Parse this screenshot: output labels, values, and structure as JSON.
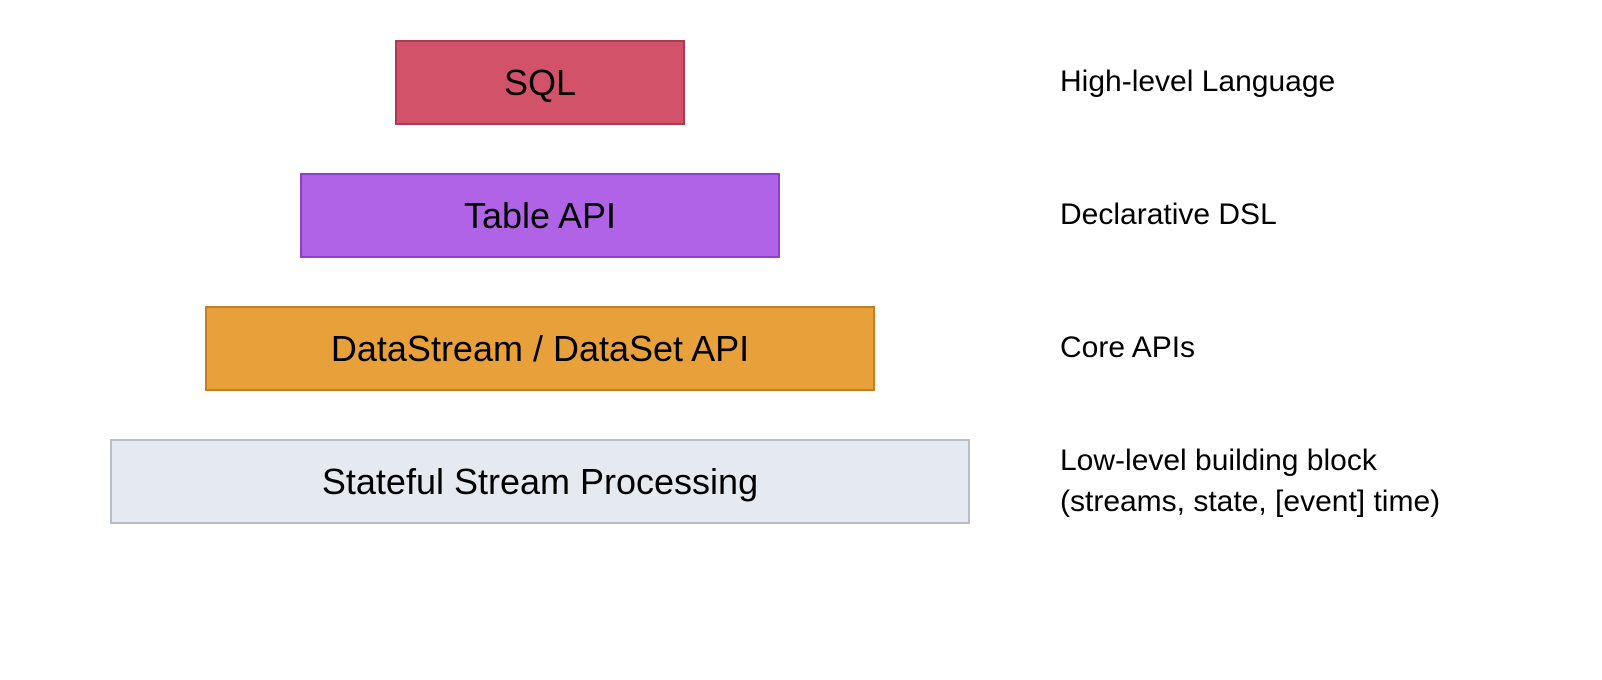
{
  "layers": [
    {
      "box_label": "SQL",
      "description": "High-level Language",
      "box_class": "box-sql"
    },
    {
      "box_label": "Table API",
      "description": "Declarative DSL",
      "box_class": "box-table"
    },
    {
      "box_label": "DataStream / DataSet API",
      "description": "Core APIs",
      "box_class": "box-datastream"
    },
    {
      "box_label": "Stateful Stream Processing",
      "description": "Low-level building block\n(streams, state, [event] time)",
      "box_class": "box-stateful"
    }
  ]
}
